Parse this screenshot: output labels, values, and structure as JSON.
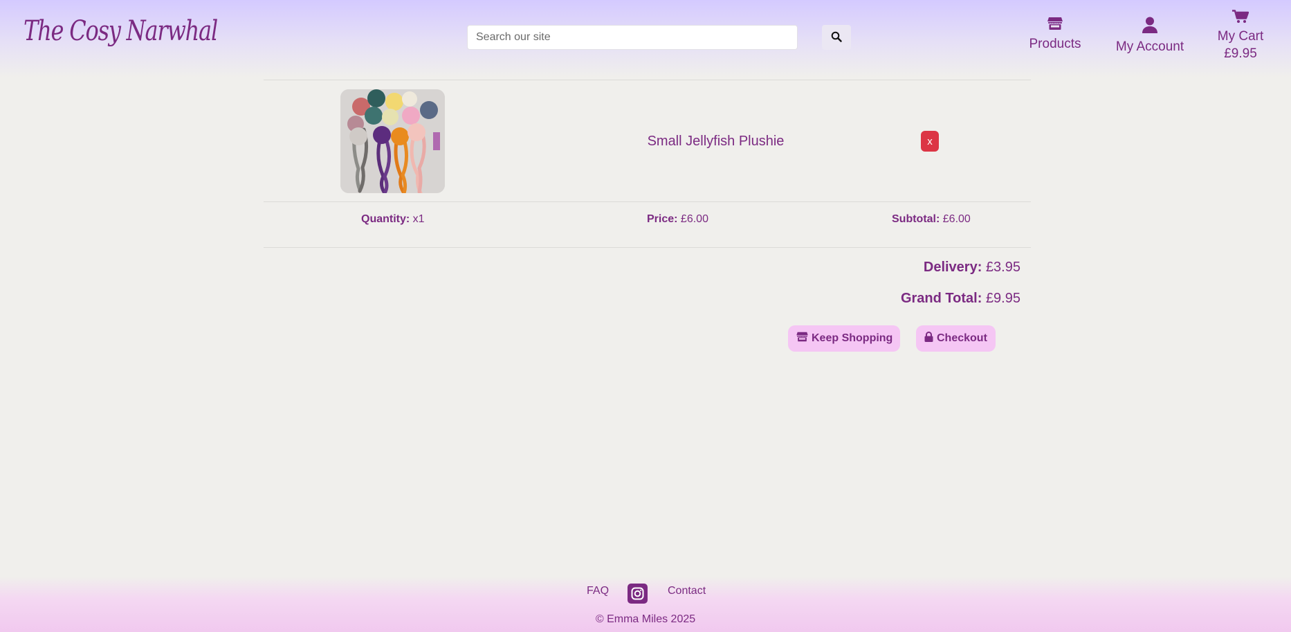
{
  "header": {
    "logo": "The Cosy Narwhal",
    "search_placeholder": "Search our site",
    "nav": {
      "products": "Products",
      "account": "My Account",
      "cart": "My Cart",
      "cart_total": "£9.95"
    }
  },
  "cart": {
    "item": {
      "name": "Small Jellyfish Plushie",
      "remove_label": "x",
      "quantity_label": "Quantity:",
      "quantity_value": "x1",
      "price_label": "Price:",
      "price_value": "£6.00",
      "subtotal_label": "Subtotal:",
      "subtotal_value": "£6.00"
    },
    "delivery_label": "Delivery:",
    "delivery_value": "£3.95",
    "grand_total_label": "Grand Total:",
    "grand_total_value": "£9.95",
    "keep_shopping": "Keep Shopping",
    "checkout": "Checkout"
  },
  "footer": {
    "faq": "FAQ",
    "contact": "Contact",
    "copyright": "© Emma Miles 2025"
  },
  "colors": {
    "brand": "#7b2a82",
    "button_bg": "#f5c6f4",
    "remove": "#dc3545",
    "page_bg": "#f0efec"
  },
  "icons": [
    "search-icon",
    "store-icon",
    "user-icon",
    "cart-icon",
    "lock-icon",
    "instagram-icon"
  ]
}
